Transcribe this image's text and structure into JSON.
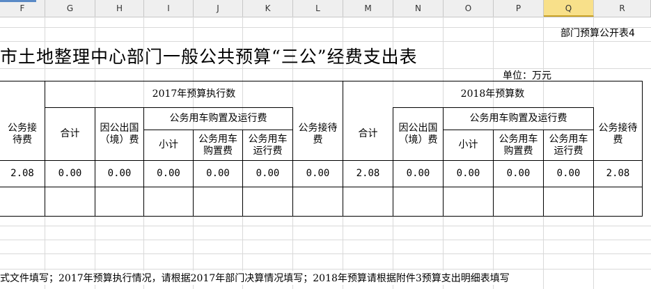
{
  "columns": [
    "F",
    "G",
    "H",
    "I",
    "J",
    "K",
    "L",
    "M",
    "N",
    "O",
    "P",
    "Q",
    "R"
  ],
  "selected_column": "Q",
  "form_id": "部门预算公开表4",
  "title": "市土地整理中心部门一般公共预算“三公”经费支出表",
  "unit": "单位：万元",
  "headers": {
    "exec2017": "2017年预算执行数",
    "budget2018": "2018年预算数",
    "reception_partial": "公务接\n待费",
    "total": "合计",
    "abroad": "因公出国\n（境）费",
    "vehicle_group": "公务用车购置及运行费",
    "subtotal": "小计",
    "purchase": "公务用车\n购置费",
    "operation": "公务用车\n运行费",
    "reception": "公务接待\n费"
  },
  "row": [
    "2.08",
    "0.00",
    "0.00",
    "0.00",
    "0.00",
    "0.00",
    "0.00",
    "2.08",
    "0.00",
    "0.00",
    "0.00",
    "0.00",
    "2.08"
  ],
  "footer": "式文件填写；2017年预算执行情况，请根据2017年部门决算情况填写；2018年预算请根据附件3预算支出明细表填写"
}
